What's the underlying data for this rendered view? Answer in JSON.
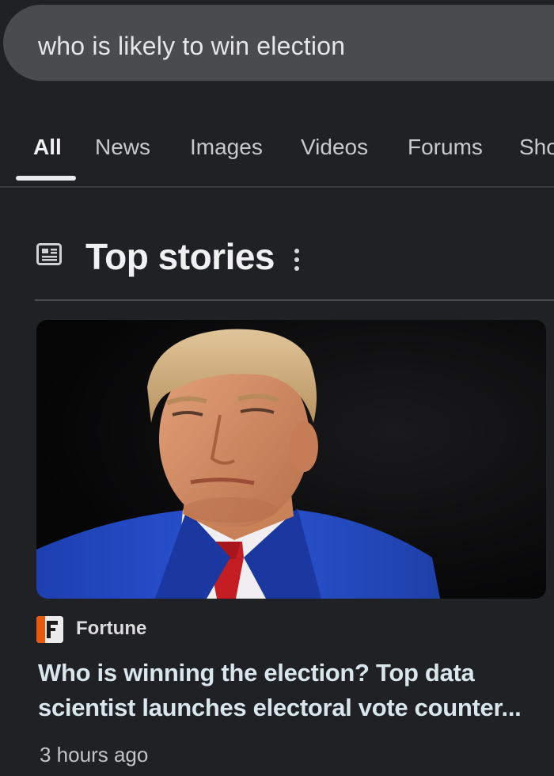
{
  "search": {
    "query": "who is likely to win election"
  },
  "tabs": [
    {
      "label": "All",
      "active": true
    },
    {
      "label": "News",
      "active": false
    },
    {
      "label": "Images",
      "active": false
    },
    {
      "label": "Videos",
      "active": false
    },
    {
      "label": "Forums",
      "active": false
    },
    {
      "label": "Sho",
      "active": false
    }
  ],
  "top_stories": {
    "title": "Top stories",
    "icon": "newspaper-icon",
    "menu_icon": "more-vertical-icon",
    "stories": [
      {
        "source": "Fortune",
        "source_logo_icon": "fortune-logo-icon",
        "headline": "Who is winning the election? Top data scientist launches electoral vote counter...",
        "time": "3 hours ago"
      }
    ]
  },
  "colors": {
    "background": "#202124",
    "search_bar": "#4a4b4f",
    "headline": "#d9e6ec",
    "active_tab_indicator": "#e8eaed"
  }
}
